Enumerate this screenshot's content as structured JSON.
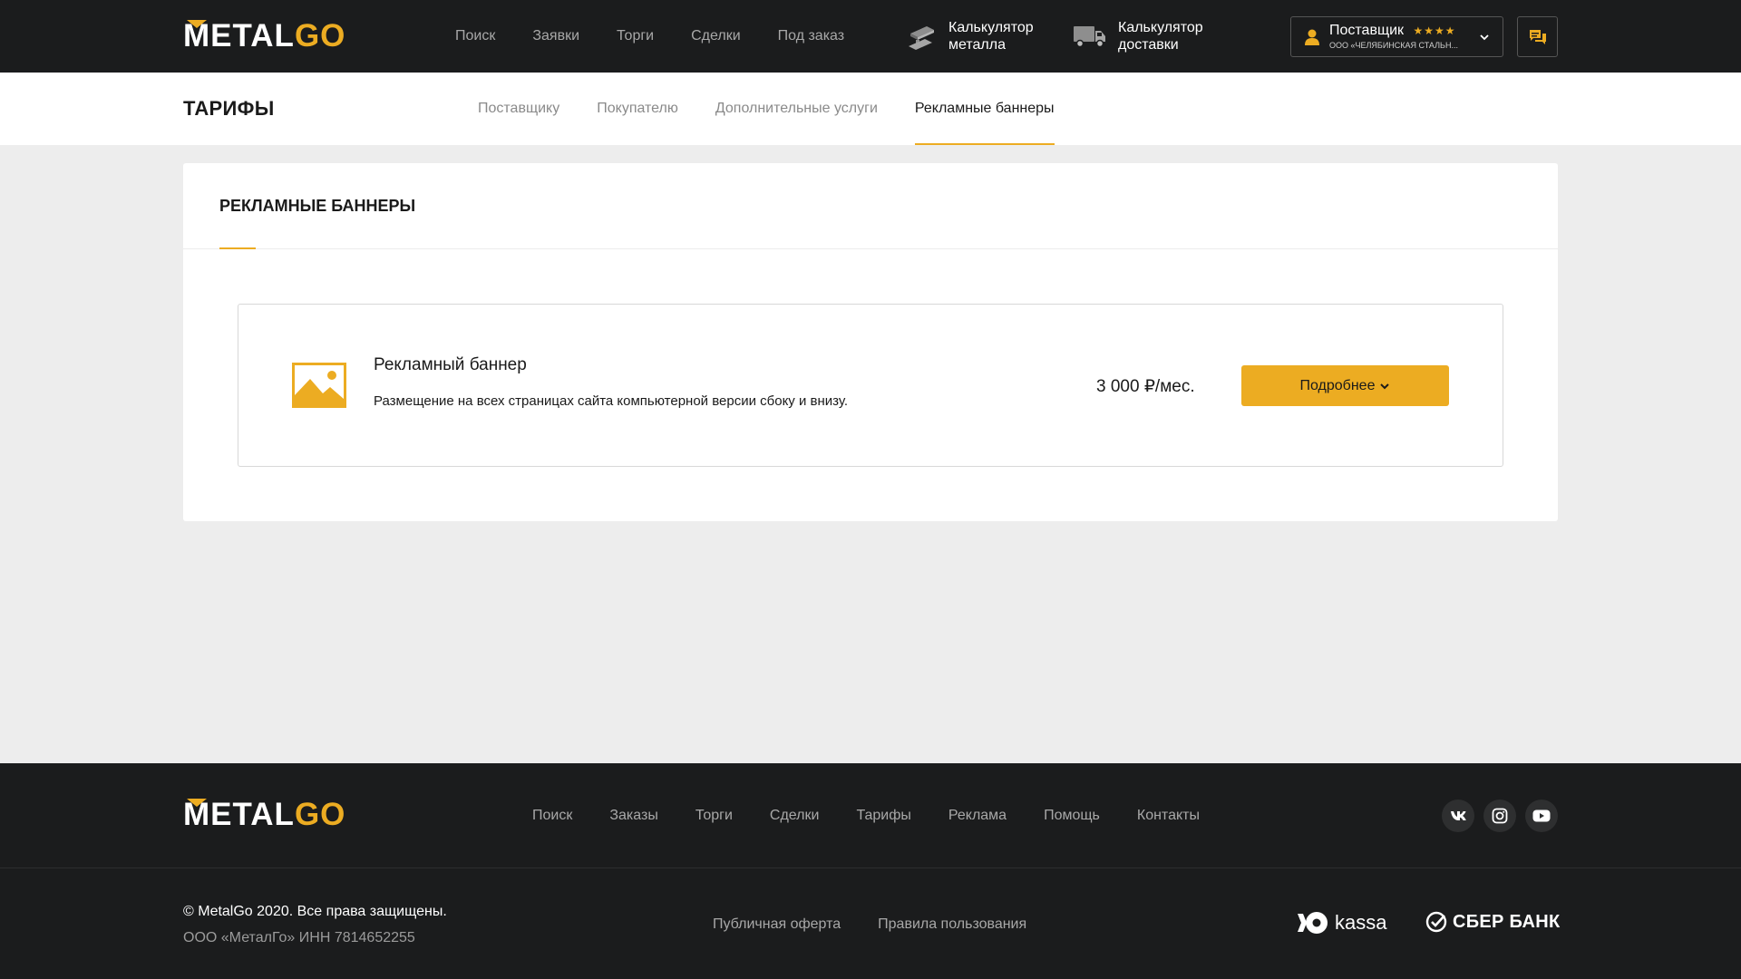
{
  "header": {
    "logo": {
      "part1": "METAL",
      "part2": "GO"
    },
    "nav": [
      "Поиск",
      "Заявки",
      "Торги",
      "Сделки",
      "Под заказ"
    ],
    "calc_metal": {
      "line1": "Калькулятор",
      "line2": "металла"
    },
    "calc_delivery": {
      "line1": "Калькулятор",
      "line2": "доставки"
    },
    "user": {
      "role": "Поставщик",
      "stars": "★★★★",
      "org": "ООО «ЧЕЛЯБИНСКАЯ СТАЛЬН..."
    }
  },
  "subheader": {
    "title": "ТАРИФЫ",
    "tabs": [
      "Поставщику",
      "Покупателю",
      "Дополнительные услуги",
      "Рекламные баннеры"
    ],
    "active_tab": "Рекламные баннеры"
  },
  "card": {
    "title": "РЕКЛАМНЫЕ БАННЕРЫ",
    "item": {
      "name": "Рекламный баннер",
      "description": "Размещение на всех страницах сайта компьютерной версии сбоку и внизу.",
      "price": "3 000 ₽/мес.",
      "button": "Подробнее"
    }
  },
  "footer": {
    "logo": {
      "part1": "METAL",
      "part2": "GO"
    },
    "nav": [
      "Поиск",
      "Заказы",
      "Торги",
      "Сделки",
      "Тарифы",
      "Реклама",
      "Помощь",
      "Контакты"
    ],
    "socials": [
      "vk-icon",
      "instagram-icon",
      "youtube-icon"
    ],
    "copyright": "© MetalGo 2020. Все права защищены.",
    "company": "ООО «МеталГо» ИНН 7814652255",
    "legal": [
      "Публичная оферта",
      "Правила пользования"
    ],
    "payments": {
      "kassa": "kassa",
      "sber": "СБЕР БАНК"
    }
  },
  "colors": {
    "accent": "#ecac22",
    "dark": "#1b1c1d",
    "background": "#ededed"
  }
}
